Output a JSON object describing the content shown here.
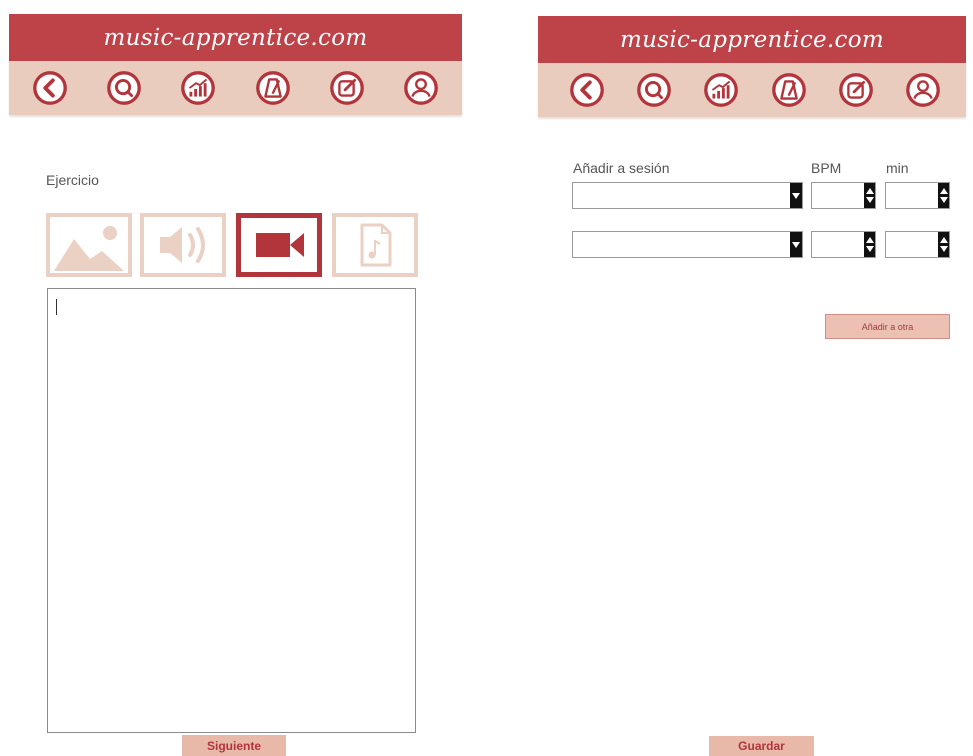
{
  "brand": "music-apprentice.com",
  "colors": {
    "brand_red": "#bd4349",
    "nav_bg": "#eaccbf",
    "accent_light": "#e8b9a9",
    "media_inactive": "#ebd0c4"
  },
  "nav_icons": [
    "back-icon",
    "search-icon",
    "stats-icon",
    "metronome-icon",
    "edit-icon",
    "profile-icon"
  ],
  "left": {
    "label": "Ejercicio",
    "media_options": [
      "image-icon",
      "audio-icon",
      "video-icon",
      "score-icon"
    ],
    "selected_media": "video-icon",
    "text_area_value": "",
    "next_label": "Siguiente"
  },
  "right": {
    "session_label": "Añadir a sesión",
    "bpm_label": "BPM",
    "min_label": "min",
    "rows": [
      {
        "session": "",
        "bpm": "",
        "min": ""
      },
      {
        "session": "",
        "bpm": "",
        "min": ""
      }
    ],
    "add_other_label": "Añadir a otra",
    "save_label": "Guardar"
  }
}
